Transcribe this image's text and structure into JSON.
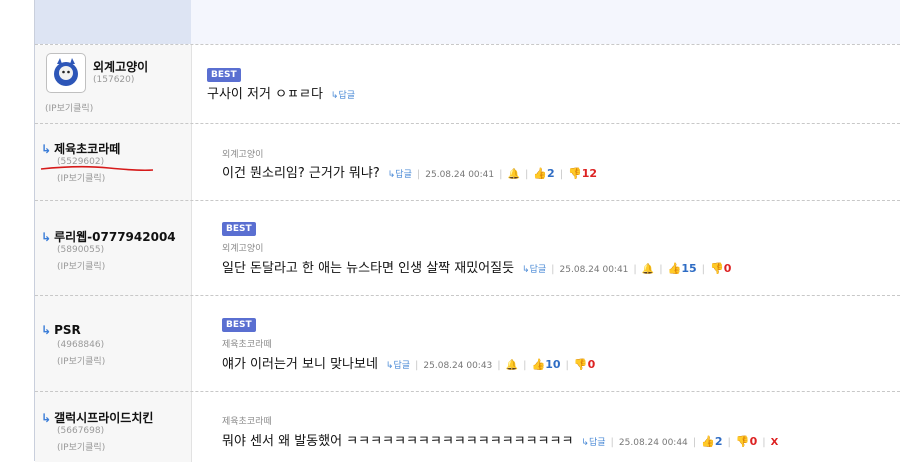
{
  "comments": [
    {
      "nick": "외계고양이",
      "uid": "(157620)",
      "ip": "(IP보기클릭)",
      "best": "BEST",
      "text": "구사이 저거 ㅇㅍㄹ다",
      "reply": "↳답글"
    },
    {
      "nick": "제육초코라떼",
      "uid": "(5529602)",
      "ip": "(IP보기클릭)",
      "ref": "외계고양이",
      "text": "이건 뭔소리임? 근거가 뭐냐?",
      "reply": "↳답글",
      "date": "25.08.24 00:41",
      "bell": "🔔",
      "up": "👍2",
      "down": "👎12"
    },
    {
      "nick": "루리웹-0777942004",
      "uid": "(5890055)",
      "ip": "(IP보기클릭)",
      "best": "BEST",
      "ref": "외계고양이",
      "text": "일단 돈달라고 한 애는 뉴스타면 인생 살짝 재밌어질듯",
      "reply": "↳답글",
      "date": "25.08.24 00:41",
      "bell": "🔔",
      "up": "👍15",
      "down": "👎0"
    },
    {
      "nick": "PSR",
      "uid": "(4968846)",
      "ip": "(IP보기클릭)",
      "best": "BEST",
      "ref": "제육초코라떼",
      "text": "얘가 이러는거 보니 맞나보네",
      "reply": "↳답글",
      "date": "25.08.24 00:43",
      "bell": "🔔",
      "up": "👍10",
      "down": "👎0"
    },
    {
      "nick": "갤럭시프라이드치킨",
      "uid": "(5667698)",
      "ip": "(IP보기클릭)",
      "ref": "제육초코라떼",
      "text": "뭐야 센서 왜 발동했어 ㅋㅋㅋㅋㅋㅋㅋㅋㅋㅋㅋㅋㅋㅋㅋㅋㅋㅋㅋ",
      "reply": "↳답글",
      "date": "25.08.24 00:44",
      "up": "👍2",
      "down": "👎0",
      "delete": "X"
    }
  ],
  "colors": {
    "best": "#5a6fd1",
    "up": "#2e6cc4",
    "down": "#dd2222",
    "reply": "#4a8ad6"
  }
}
